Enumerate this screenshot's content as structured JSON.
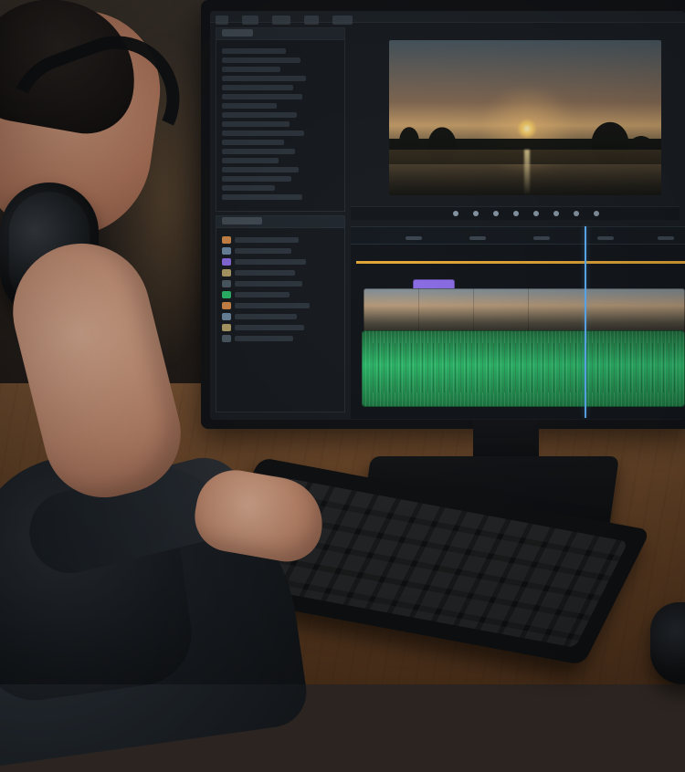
{
  "scene": {
    "palette": {
      "accent_blue": "#62b6ff",
      "marker_yellow": "#f0b13a",
      "audio_green": "#2dbb6b",
      "clip_purple": "#8c6ee6",
      "desk_wood": "#6a4628"
    },
    "icons": [
      "headphones-icon",
      "keyboard-icon",
      "mouse-icon",
      "monitor-icon",
      "timeline-icon",
      "video-preview-icon"
    ]
  }
}
